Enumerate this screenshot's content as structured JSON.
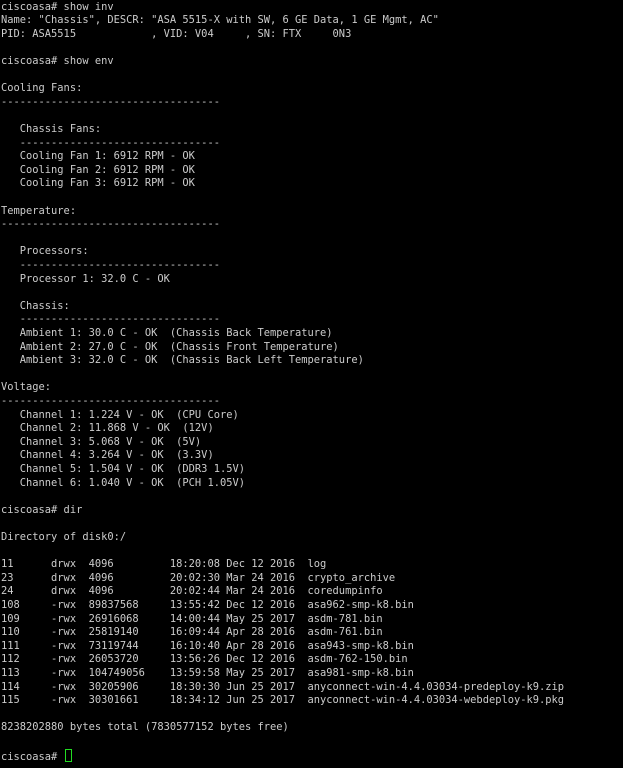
{
  "terminal": {
    "text_color": "#cccccc",
    "background": "#000000",
    "cursor_color": "#22dd22",
    "lines": [
      "ciscoasa# show inv",
      "Name: \"Chassis\", DESCR: \"ASA 5515-X with SW, 6 GE Data, 1 GE Mgmt, AC\"",
      "PID: ASA5515            , VID: V04     , SN: FTX     0N3",
      "",
      "ciscoasa# show env",
      "",
      "Cooling Fans:",
      "-----------------------------------",
      "",
      "   Chassis Fans:",
      "   --------------------------------",
      "   Cooling Fan 1: 6912 RPM - OK",
      "   Cooling Fan 2: 6912 RPM - OK",
      "   Cooling Fan 3: 6912 RPM - OK",
      "",
      "Temperature:",
      "-----------------------------------",
      "",
      "   Processors:",
      "   --------------------------------",
      "   Processor 1: 32.0 C - OK",
      "",
      "   Chassis:",
      "   --------------------------------",
      "   Ambient 1: 30.0 C - OK  (Chassis Back Temperature)",
      "   Ambient 2: 27.0 C - OK  (Chassis Front Temperature)",
      "   Ambient 3: 32.0 C - OK  (Chassis Back Left Temperature)",
      "",
      "Voltage:",
      "-----------------------------------",
      "   Channel 1: 1.224 V - OK  (CPU Core)",
      "   Channel 2: 11.868 V - OK  (12V)",
      "   Channel 3: 5.068 V - OK  (5V)",
      "   Channel 4: 3.264 V - OK  (3.3V)",
      "   Channel 5: 1.504 V - OK  (DDR3 1.5V)",
      "   Channel 6: 1.040 V - OK  (PCH 1.05V)",
      "",
      "ciscoasa# dir",
      "",
      "Directory of disk0:/",
      "",
      "11      drwx  4096         18:20:08 Dec 12 2016  log",
      "23      drwx  4096         20:02:30 Mar 24 2016  crypto_archive",
      "24      drwx  4096         20:02:44 Mar 24 2016  coredumpinfo",
      "108     -rwx  89837568     13:55:42 Dec 12 2016  asa962-smp-k8.bin",
      "109     -rwx  26916068     14:00:44 May 25 2017  asdm-781.bin",
      "110     -rwx  25819140     16:09:44 Apr 28 2016  asdm-761.bin",
      "111     -rwx  73119744     16:10:40 Apr 28 2016  asa943-smp-k8.bin",
      "112     -rwx  26053720     13:56:26 Dec 12 2016  asdm-762-150.bin",
      "113     -rwx  104749056    13:59:58 May 25 2017  asa981-smp-k8.bin",
      "114     -rwx  30205906     18:30:30 Jun 25 2017  anyconnect-win-4.4.03034-predeploy-k9.zip",
      "115     -rwx  30301661     18:34:12 Jun 25 2017  anyconnect-win-4.4.03034-webdeploy-k9.pkg",
      "",
      "8238202880 bytes total (7830577152 bytes free)",
      "",
      "ciscoasa# "
    ]
  }
}
